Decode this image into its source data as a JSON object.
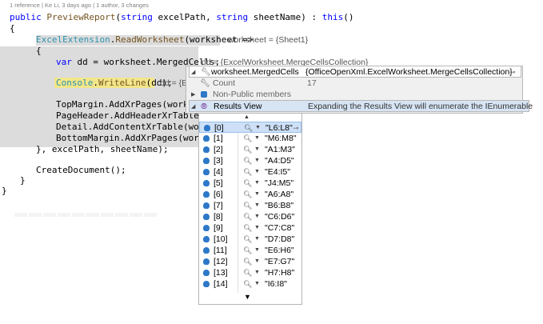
{
  "codelens": "1 reference | Ke Li, 3 days ago | 1 author, 3 changes",
  "code": {
    "l1_kw": "public",
    "l1_name": "PreviewReport",
    "l1_p1": "(",
    "l1_kw2": "string",
    "l1_p2": " excelPath, ",
    "l1_kw3": "string",
    "l1_p3": " sheetName) : ",
    "l1_kw4": "this",
    "l1_p4": "()",
    "l2": "{",
    "l3_type": "ExcelExtension",
    "l3_dot": ".",
    "l3_method": "ReadWorksheet",
    "l3_rest": "(worksheet =>",
    "l3_tip": "worksheet = {Sheet1}",
    "l4": "{",
    "l5_kw": "var",
    "l5_rest": " dd = worksheet.MergedCells;",
    "l5_tip": "dd = {ExcelWorksheet.MergeCellsCollection}",
    "l6_type": "Console",
    "l6_dot": ".",
    "l6_method": "WriteLine",
    "l6_rest": "(dd);",
    "l6_tip": "dd = {E",
    "l7": "TopMargin.AddXrPages(worksheet",
    "l8": "PageHeader.AddHeaderXrTable(wo",
    "l9": "Detail.AddContentXrTable(workshe",
    "l10": "BottomMargin.AddXrPages(workshee",
    "l11": "}, excelPath, sheetName);",
    "l12": "CreateDocument();",
    "l13": "}",
    "l14": "}"
  },
  "datatip": {
    "header_name": "worksheet.MergedCells",
    "header_value": "{OfficeOpenXml.ExcelWorksheet.MergeCellsCollection}",
    "rows": [
      {
        "name": "Count",
        "value": "17"
      },
      {
        "name": "Non-Public members",
        "value": ""
      },
      {
        "name": "Results View",
        "value": "Expanding the Results View will enumerate the IEnumerable"
      }
    ]
  },
  "results": [
    {
      "idx": "[0]",
      "val": "\"L6:L8\""
    },
    {
      "idx": "[1]",
      "val": "\"M6:M8\""
    },
    {
      "idx": "[2]",
      "val": "\"A1:M3\""
    },
    {
      "idx": "[3]",
      "val": "\"A4:D5\""
    },
    {
      "idx": "[4]",
      "val": "\"E4:I5\""
    },
    {
      "idx": "[5]",
      "val": "\"J4:M5\""
    },
    {
      "idx": "[6]",
      "val": "\"A6:A8\""
    },
    {
      "idx": "[7]",
      "val": "\"B6:B8\""
    },
    {
      "idx": "[8]",
      "val": "\"C6:D6\""
    },
    {
      "idx": "[9]",
      "val": "\"C7:C8\""
    },
    {
      "idx": "[10]",
      "val": "\"D7:D8\""
    },
    {
      "idx": "[11]",
      "val": "\"E6:H6\""
    },
    {
      "idx": "[12]",
      "val": "\"E7:G7\""
    },
    {
      "idx": "[13]",
      "val": "\"H7:H8\""
    },
    {
      "idx": "[14]",
      "val": "\"I6:I8\""
    }
  ]
}
